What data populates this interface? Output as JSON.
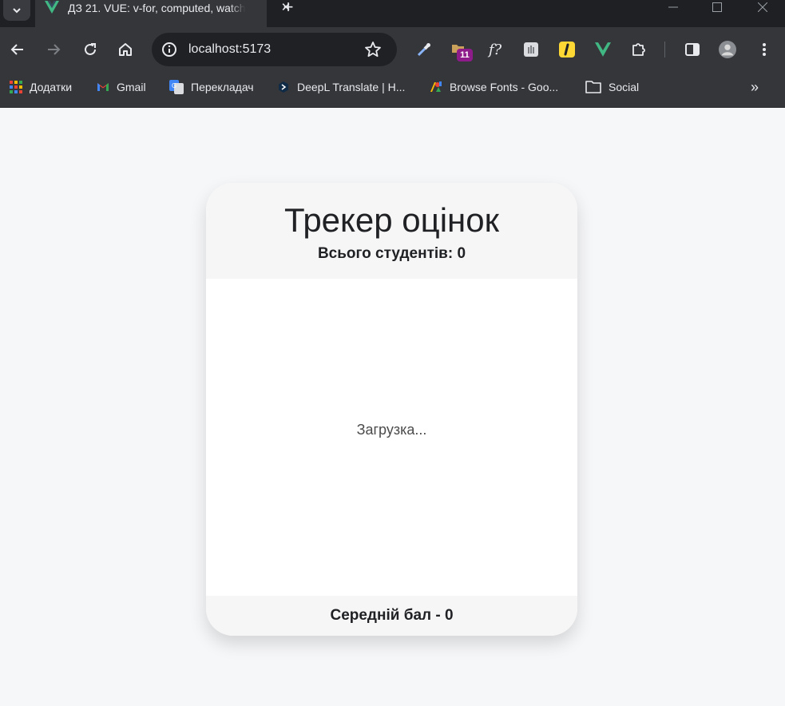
{
  "browser": {
    "tab": {
      "title": "ДЗ 21. VUE: v-for, computed, watch",
      "close": "✕"
    },
    "new_tab": "+",
    "address": {
      "url": "localhost:5173"
    },
    "extensions": {
      "badge_count": "11",
      "f_label": "f?"
    },
    "bookmarks": [
      {
        "label": "Додатки"
      },
      {
        "label": "Gmail"
      },
      {
        "label": "Перекладач"
      },
      {
        "label": "DeepL Translate | H..."
      },
      {
        "label": "Browse Fonts - Goo..."
      },
      {
        "label": "Social"
      }
    ],
    "bookmarks_more": "»"
  },
  "app": {
    "title": "Трекер оцінок",
    "subtitle": "Всього студентів: 0",
    "loading": "Загрузка...",
    "footer": "Середній бал - 0"
  },
  "colors": {
    "accent_vue": "#41b883",
    "page_bg": "#f6f7f9",
    "chrome_dark": "#35363a"
  }
}
